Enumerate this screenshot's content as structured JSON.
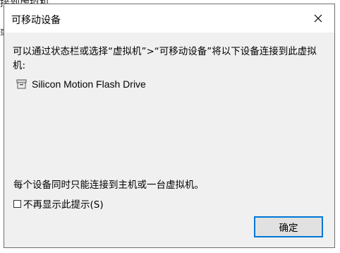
{
  "background_window": {
    "title_fragment": "接到虚拟机",
    "side_fragment": "或"
  },
  "dialog": {
    "title": "可移动设备",
    "close_icon": "close-icon",
    "description": "可以通过状态栏或选择“虚拟机”>“可移动设备”将以下设备连接到此虚拟机:",
    "devices": [
      {
        "label": "Silicon Motion Flash Drive",
        "icon": "removable-drive-icon"
      }
    ],
    "note": "每个设备同时只能连接到主机或一台虚拟机。",
    "checkbox": {
      "label": "不再显示此提示(S)",
      "checked": false
    },
    "ok_button": "确定"
  },
  "colors": {
    "accent": "#0078d7",
    "dialog_bg": "#f0f0f0",
    "titlebar_bg": "#ffffff"
  }
}
